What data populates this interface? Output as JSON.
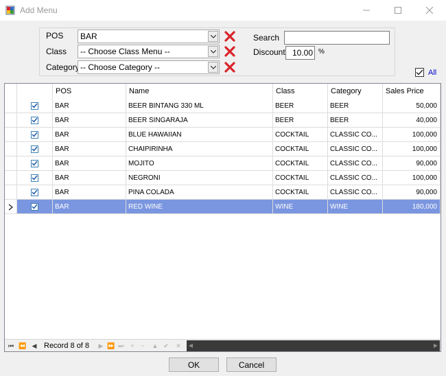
{
  "window": {
    "title": "Add Menu"
  },
  "filters": {
    "pos_label": "POS",
    "pos_value": "BAR",
    "class_label": "Class",
    "class_value": "-- Choose Class Menu --",
    "category_label": "Category",
    "category_value": "-- Choose Category --",
    "search_label": "Search",
    "search_value": "",
    "discount_label": "Discount",
    "discount_value": "10.00",
    "discount_unit": "%",
    "all_label": "All",
    "all_checked": true
  },
  "grid": {
    "columns": [
      "POS",
      "Name",
      "Class",
      "Category",
      "Sales Price"
    ],
    "rows": [
      {
        "checked": true,
        "pos": "BAR",
        "name": "BEER BINTANG 330 ML",
        "class": "BEER",
        "category": "BEER",
        "price": "50,000"
      },
      {
        "checked": true,
        "pos": "BAR",
        "name": "BEER SINGARAJA",
        "class": "BEER",
        "category": "BEER",
        "price": "40,000"
      },
      {
        "checked": true,
        "pos": "BAR",
        "name": "BLUE HAWAIIAN",
        "class": "COCKTAIL",
        "category": "CLASSIC CO...",
        "price": "100,000"
      },
      {
        "checked": true,
        "pos": "BAR",
        "name": "CHAIPIRINHA",
        "class": "COCKTAIL",
        "category": "CLASSIC CO...",
        "price": "100,000"
      },
      {
        "checked": true,
        "pos": "BAR",
        "name": "MOJITO",
        "class": "COCKTAIL",
        "category": "CLASSIC CO...",
        "price": "90,000"
      },
      {
        "checked": true,
        "pos": "BAR",
        "name": "NEGRONI",
        "class": "COCKTAIL",
        "category": "CLASSIC CO...",
        "price": "100,000"
      },
      {
        "checked": true,
        "pos": "BAR",
        "name": "PINA COLADA",
        "class": "COCKTAIL",
        "category": "CLASSIC CO...",
        "price": "90,000"
      },
      {
        "checked": true,
        "pos": "BAR",
        "name": "RED WINE",
        "class": "WINE",
        "category": "WINE",
        "price": "180,000"
      }
    ],
    "selected_row": 8,
    "navigator_text": "Record 8 of 8"
  },
  "buttons": {
    "ok": "OK",
    "cancel": "Cancel"
  },
  "colors": {
    "selection": "#7b96e0",
    "delete_x": "#d9252a",
    "check_blue": "#3c7fb1"
  }
}
